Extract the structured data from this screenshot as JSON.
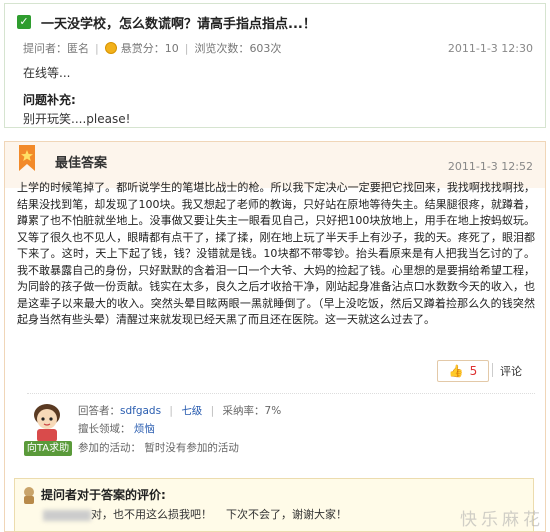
{
  "question": {
    "title": "一天没学校，怎么数谎啊？请高手指点指点...！",
    "asker_label": "提问者：",
    "asker": "匿名",
    "bounty_label": "悬赏分：",
    "bounty": "10",
    "views_label": "浏览次数：",
    "views": "603次",
    "date": "2011-1-3 12:30",
    "body": "在线等...",
    "supplement_title": "问题补充:",
    "supplement_text": "别开玩笑....please!"
  },
  "answer": {
    "section_title": "最佳答案",
    "date": "2011-1-3 12:52",
    "body": "上学的时候笔掉了。都听说学生的笔堪比战士的枪。所以我下定决心一定要把它找回来，我找啊找找啊找，结果没找到笔，却发现了100块。我又想起了老师的教诲，只好站在原地等待失主。结果腿很疼，就蹲着，蹲累了也不怕脏就坐地上。没事做又要让失主一眼看见自己，只好把100块放地上，用手在地上按蚂蚁玩。又等了很久也不见人，眼睛都有点干了，揉了揉，刚在地上玩了半天手上有沙子，我的天。疼死了，眼泪都下来了。这时，天上下起了钱，钱？没错就是钱。10块都不带零钞。抬头看原来是有人把我当乞讨的了。我不敢暴露自己的身份，只好默默的含着泪一口一个大爷、大妈的捡起了钱。心里想的是要捐给希望工程，为同龄的孩子做一份贡献。钱实在太多，良久之后才收拾干净，刚站起身准备沾点口水数数今天的收入，也是这辈子以来最大的收入。突然头晕目眩两眼一黑就睡倒了。（早上没吃饭，然后又蹲着捡那么久的钱突然起身当然有些头晕）清醒过来就发现已经天黑了而且还在医院。这一天就这么过去了。",
    "vote_count": "5",
    "comment_label": "评论",
    "answerer_label": "回答者：",
    "answerer": "sdfgads",
    "level": "七级",
    "adoption_label": "采纳率：",
    "adoption_rate": "7%",
    "expertise_label": "擅长领域：",
    "expertise": "烦恼",
    "activity_label": "参加的活动：",
    "activity": "暂时没有参加的活动",
    "help_badge": "向TA求助"
  },
  "evaluation": {
    "title": "提问者对于答案的评价:",
    "text_before": "对，也不用这么损我吧！",
    "text_after": "下次不会了，谢谢大家！"
  },
  "watermark": "快乐麻花",
  "colors": {
    "check_green": "#2f9d2f",
    "answer_header_bg": "#fdf5ec",
    "link_blue": "#2a5db0",
    "vote_red": "#dd3333",
    "eval_bg": "#fffbe8"
  }
}
